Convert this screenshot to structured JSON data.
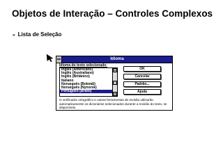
{
  "slide": {
    "title": "Objetos de Interação – Controles Complexos",
    "bullet_marker": "-",
    "bullet_text": "Lista de Seleção"
  },
  "dialog": {
    "title": "Idioma",
    "list_label": "Idioma do texto selecionado:",
    "list_items": [
      "Inglês (Americano)",
      "Inglês (Australiano)",
      "Inglês (Britânico)",
      "Italiano",
      "Norueguês (Bokmål)",
      "Norueguês (Nynorsk)",
      "Português (Brasil)"
    ],
    "selected_item": "Português (Brasil)",
    "buttons": {
      "ok": "OK",
      "cancel": "Cancelar",
      "default": "Padrão...",
      "help": "Ajuda"
    },
    "description": "O verificador ortográfico e outras ferramentas de revisão utilizarão automaticamente os dicionários selecionados durante a revisão do texto, se disponíveis.",
    "colors": {
      "titlebar": "#1c1c8c",
      "selection": "#1c1c8c"
    }
  }
}
